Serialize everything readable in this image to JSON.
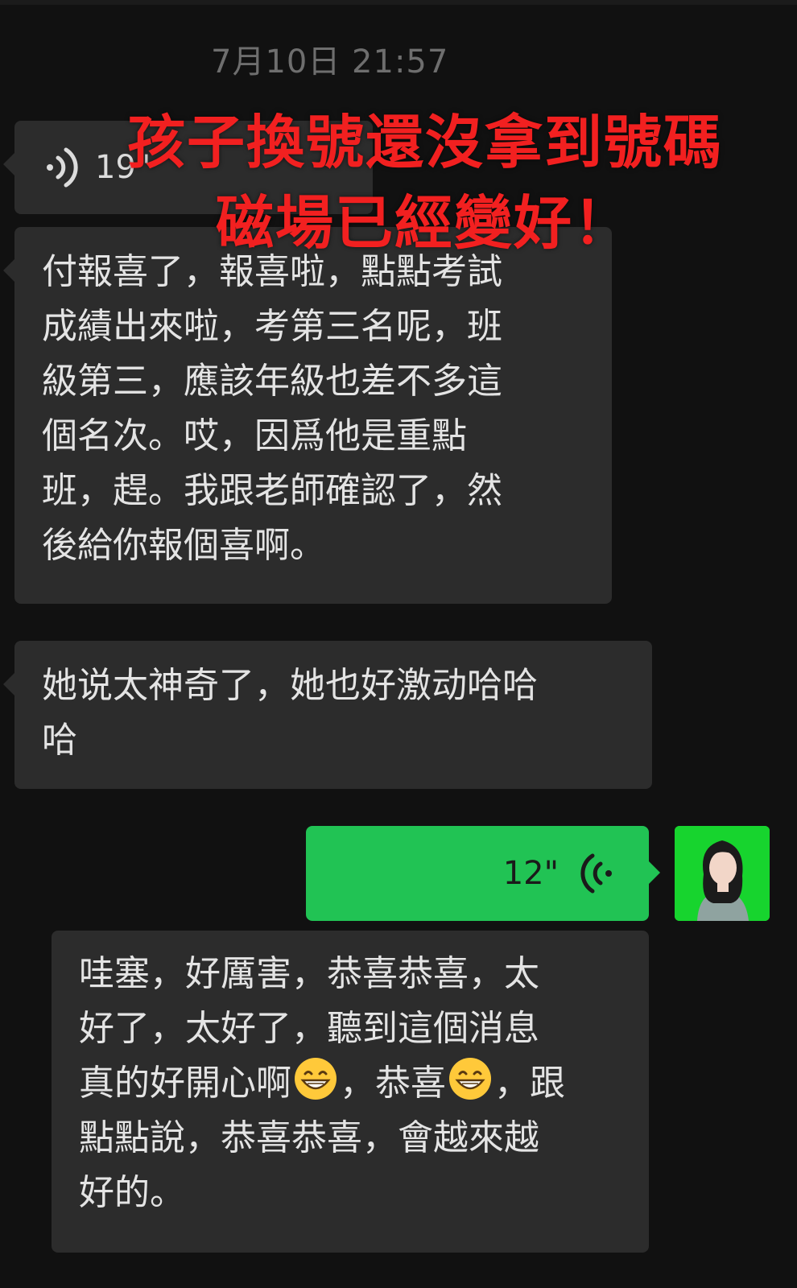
{
  "chat": {
    "timestamp": "7月10日 21:57",
    "overlay_caption": {
      "line1": "孩子換號還沒拿到號碼",
      "line2": "磁場已經變好！"
    },
    "messages": [
      {
        "type": "voice",
        "side": "left",
        "duration": "19\""
      },
      {
        "type": "text",
        "side": "left",
        "lines": [
          "付報喜了，報喜啦，點點考試",
          "成績出來啦，考第三名呢，班",
          "級第三，應該年級也差不多這",
          "個名次。哎，因爲他是重點",
          "班，趕。我跟老師確認了，然",
          "後給你報個喜啊。"
        ]
      },
      {
        "type": "text",
        "side": "left",
        "lines": [
          "她说太神奇了，她也好激动哈哈",
          "哈"
        ]
      },
      {
        "type": "voice",
        "side": "right",
        "duration": "12\""
      },
      {
        "type": "text",
        "side": "left",
        "lines": [
          "哇塞，好厲害，恭喜恭喜，太",
          "好了，太好了，聽到這個消息",
          "真的好開心啊",
          "，恭喜",
          "，跟",
          "點點說，恭喜恭喜，會越來越",
          "好的。"
        ]
      }
    ]
  },
  "icons": {
    "voice_left": "voice-wave-icon",
    "voice_right": "voice-wave-icon",
    "emoji": "grinning-face-icon"
  },
  "colors": {
    "background": "#111111",
    "bubble_left": "#2c2c2c",
    "bubble_right": "#21c354",
    "overlay_text": "#f22020"
  }
}
